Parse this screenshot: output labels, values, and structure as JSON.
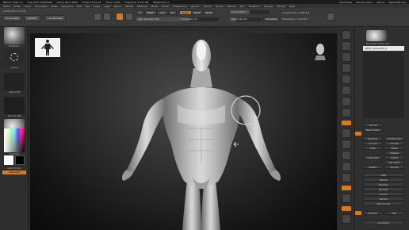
{
  "titlebar": {
    "app": "ZBrush 2021.1.1",
    "items": [
      "Free Mem 56.884GB",
      "Active Mem 3466",
      "Scratch Disk 48",
      "Timer 0.183",
      "PolyCount 3.247 MP",
      "MeshCount 1"
    ],
    "right": [
      "QuickSave",
      "See-through 0",
      "Menus",
      "DefaultZScript"
    ]
  },
  "menubar": [
    "Alpha",
    "Brush",
    "Color",
    "Document",
    "Draw",
    "Dynamics",
    "Edit",
    "File",
    "Layer",
    "Light",
    "Macro",
    "Marker",
    "Material",
    "Movie",
    "Picker",
    "Preferences",
    "Render",
    "Stencil",
    "Stroke",
    "Texture",
    "Tool",
    "Transform",
    "Zplugin",
    "Zscript",
    "Help"
  ],
  "toolbar": {
    "coords": "0.093,0.257,-0.728",
    "home_page": "Home Page",
    "lightbox": "LightBox",
    "live_boolean": "Live Boolean",
    "a_label": "A",
    "mrgb": "Mrgb",
    "rgb": "Rgb",
    "m": "M",
    "zadd": "Zadd",
    "zsub": "Zsub",
    "zcut": "Zcut",
    "rgb_intensity": "Rgb Intensity 100",
    "z_intensity": "Z Intensity 25",
    "focal_shift": "Focal Shift 0",
    "draw_size": "Draw Size 64",
    "dynamic": "Dynamic",
    "active_points": "ActivePoints: 3.388 Mil",
    "total_points": "TotalPoints: 3.322 Mil"
  },
  "left": {
    "brush_label": "MaskPen",
    "stroke_label": "Circle",
    "alpha_label": "Alpha Off",
    "texture_label": "Texture Off",
    "material_label": "SkinShade4",
    "gradient_label": "Gradient",
    "switch_label": "SwitchColor",
    "alternate_label": "Alternate"
  },
  "panel": {
    "tool_name": "Roundshoulder_Cut",
    "subtool_name": "PM3D_Sphere3D_2",
    "list_all": "List All",
    "new_folder": "New Folder",
    "rename": "Rename",
    "autoreorder": "AutoReorder",
    "all_low": "All Low",
    "all_high": "All High",
    "copy": "Copy",
    "paste": "Paste",
    "append": "Append",
    "duplicate": "Duplicate",
    "insert": "Insert",
    "delete": "Delete",
    "del_other": "Del Other",
    "del_all": "Del All",
    "split": "Split",
    "merge": "Merge",
    "boolean": "Boolean",
    "remesh": "Remesh",
    "project": "Project",
    "extract": "Extract",
    "polygroups": "Polygroups",
    "geometry": "Geometry",
    "double": "Double",
    "flip": "Flip"
  }
}
